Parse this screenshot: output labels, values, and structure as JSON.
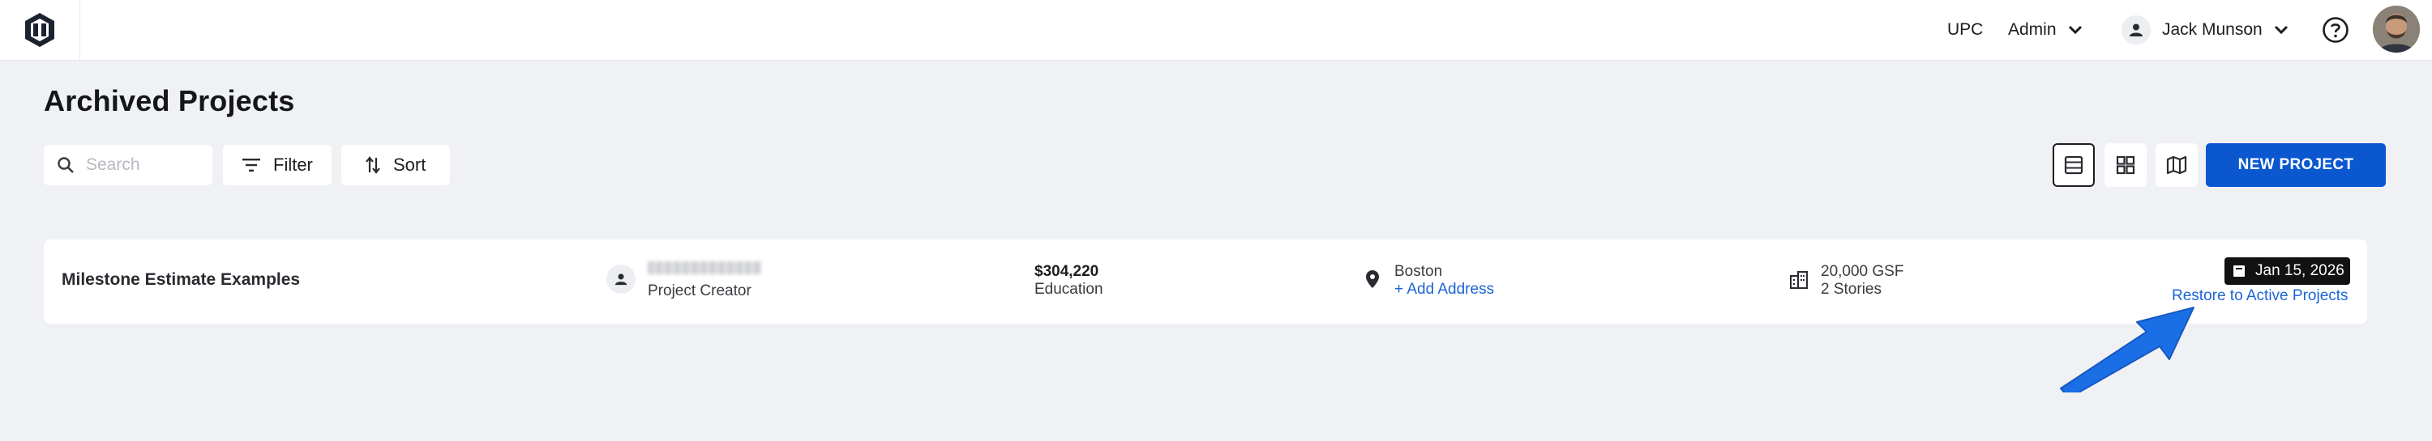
{
  "header": {
    "org": "UPC",
    "role": "Admin",
    "user_name": "Jack Munson"
  },
  "page": {
    "title": "Archived Projects"
  },
  "toolbar": {
    "search_placeholder": "Search",
    "filter_label": "Filter",
    "sort_label": "Sort",
    "views": [
      "list-view-icon",
      "grid-view-icon",
      "map-view-icon"
    ],
    "active_view": "list-view-icon",
    "new_project_label": "NEW PROJECT"
  },
  "projects": [
    {
      "name": "Milestone Estimate Examples",
      "creator_role": "Project Creator",
      "cost": "$304,220",
      "category": "Education",
      "city": "Boston",
      "add_address": "+ Add Address",
      "gsf": "20,000 GSF",
      "stories": "2 Stories",
      "date": "Jan 15, 2026",
      "restore_label": "Restore to Active Projects"
    }
  ],
  "colors": {
    "accent": "#0a57d0",
    "link": "#1c65d6",
    "background": "#f0f1f4",
    "annotation_arrow": "#1b6fe6"
  }
}
